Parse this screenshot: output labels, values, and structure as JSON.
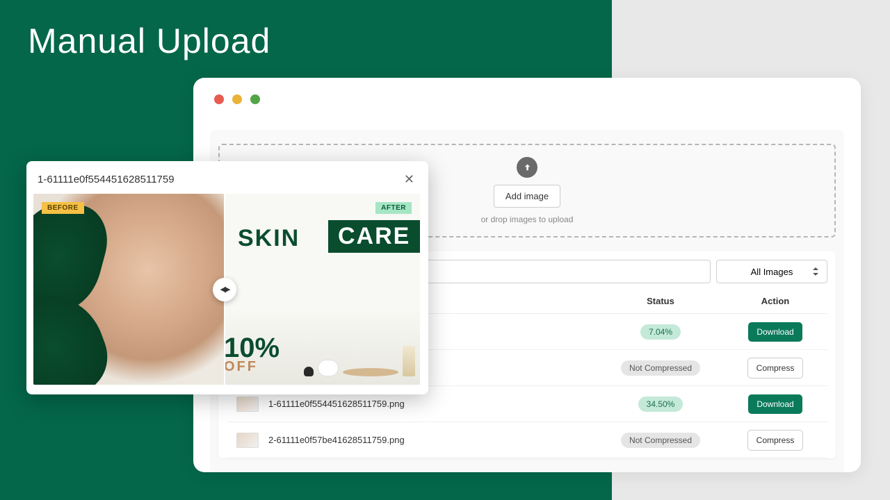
{
  "page": {
    "title": "Manual Upload"
  },
  "dropzone": {
    "button": "Add image",
    "hint": "or drop images to upload"
  },
  "filter": {
    "select_label": "All Images"
  },
  "table": {
    "headers": {
      "status": "Status",
      "action": "Action"
    },
    "rows": [
      {
        "name": "",
        "status_type": "pct",
        "status": "7.04%",
        "action": "Download"
      },
      {
        "name": "",
        "status_type": "not",
        "status": "Not Compressed",
        "action": "Compress"
      },
      {
        "name": "1-61111e0f554451628511759.png",
        "status_type": "pct",
        "status": "34.50%",
        "action": "Download"
      },
      {
        "name": "2-61111e0f57be41628511759.png",
        "status_type": "not",
        "status": "Not Compressed",
        "action": "Compress"
      }
    ]
  },
  "preview": {
    "title": "1-61111e0f554451628511759",
    "before_label": "BEFORE",
    "after_label": "AFTER",
    "ad": {
      "skin": "SKIN",
      "care": "CARE",
      "discount": "10%",
      "off": "OFF"
    }
  },
  "buttons": {
    "download": "Download",
    "compress": "Compress"
  }
}
